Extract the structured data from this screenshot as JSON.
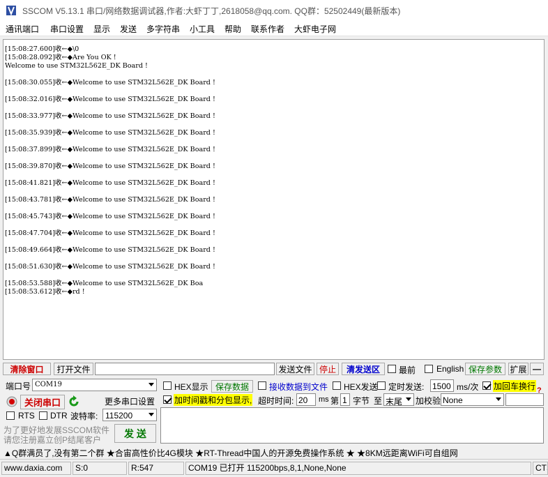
{
  "title": "SSCOM V5.13.1 串口/网络数据调试器,作者:大虾丁丁,2618058@qq.com. QQ群：52502449(最新版本)",
  "menu": [
    "通讯端口",
    "串口设置",
    "显示",
    "发送",
    "多字符串",
    "小工具",
    "帮助",
    "联系作者",
    "大虾电子网"
  ],
  "receive_lines": [
    "[15:08:27.600]收←◆\\0",
    "[15:08:28.092]收←◆Are You OK !",
    "Welcome to use STM32L562E_DK Board !",
    "",
    "[15:08:30.055]收←◆Welcome to use STM32L562E_DK Board !",
    "",
    "[15:08:32.016]收←◆Welcome to use STM32L562E_DK Board !",
    "",
    "[15:08:33.977]收←◆Welcome to use STM32L562E_DK Board !",
    "",
    "[15:08:35.939]收←◆Welcome to use STM32L562E_DK Board !",
    "",
    "[15:08:37.899]收←◆Welcome to use STM32L562E_DK Board !",
    "",
    "[15:08:39.870]收←◆Welcome to use STM32L562E_DK Board !",
    "",
    "[15:08:41.821]收←◆Welcome to use STM32L562E_DK Board !",
    "",
    "[15:08:43.781]收←◆Welcome to use STM32L562E_DK Board !",
    "",
    "[15:08:45.743]收←◆Welcome to use STM32L562E_DK Board !",
    "",
    "[15:08:47.704]收←◆Welcome to use STM32L562E_DK Board !",
    "",
    "[15:08:49.664]收←◆Welcome to use STM32L562E_DK Board !",
    "",
    "[15:08:51.630]收←◆Welcome to use STM32L562E_DK Board !",
    "",
    "[15:08:53.588]收←◆Welcome to use STM32L562E_DK Boa",
    "[15:08:53.612]收←◆rd !"
  ],
  "toolbar": {
    "clear": "清除窗口",
    "open_file": "打开文件",
    "file_path": "",
    "send_file": "发送文件",
    "stop": "停止",
    "clear_send": "清发送区",
    "topmost": "最前",
    "english": "English",
    "save_params": "保存参数",
    "expand": "扩展",
    "collapse": "—"
  },
  "port": {
    "label": "端口号",
    "value": "COM19",
    "close_btn": "关闭串口",
    "more_settings": "更多串口设置",
    "rts": "RTS",
    "dtr": "DTR",
    "baud_label": "波特率:",
    "baud_value": "115200"
  },
  "options": {
    "hex_display": "HEX显示",
    "save_data": "保存数据",
    "recv_to_file": "接收数据到文件",
    "hex_send": "HEX发送",
    "timed_send": "定时发送:",
    "interval": "1500",
    "interval_unit": "ms/次",
    "add_crlf": "加回车换行",
    "timestamp": "加时间戳和分包显示,",
    "timeout_label": "超时时间:",
    "timeout_value": "20",
    "timeout_unit": "ms",
    "byte_prefix": "第",
    "byte_index": "1",
    "byte_unit": "字节",
    "to_label": "至",
    "to_value": "末尾",
    "checksum_label": "加校验",
    "checksum_value": "None",
    "help_mark": "?"
  },
  "send": {
    "button": "发 送",
    "promo1": "为了更好地发展SSCOM软件",
    "promo2": "请您注册嘉立创P结尾客户",
    "text": ""
  },
  "adbar": "▲Q群满员了,没有第二个群  ★合宙高性价比4G模块  ★RT-Thread中国人的开源免费操作系统  ★  ★8KM远距离WiFi可自组网",
  "status": {
    "site": "www.daxia.com",
    "s": "S:0",
    "r": "R:547",
    "port_info": "COM19 已打开  115200bps,8,1,None,None",
    "cts": "CTS"
  },
  "colors": {
    "red_text": "#cc0000",
    "green_text": "#007700",
    "blue_text": "#0000cc",
    "highlight": "#ffff00"
  }
}
